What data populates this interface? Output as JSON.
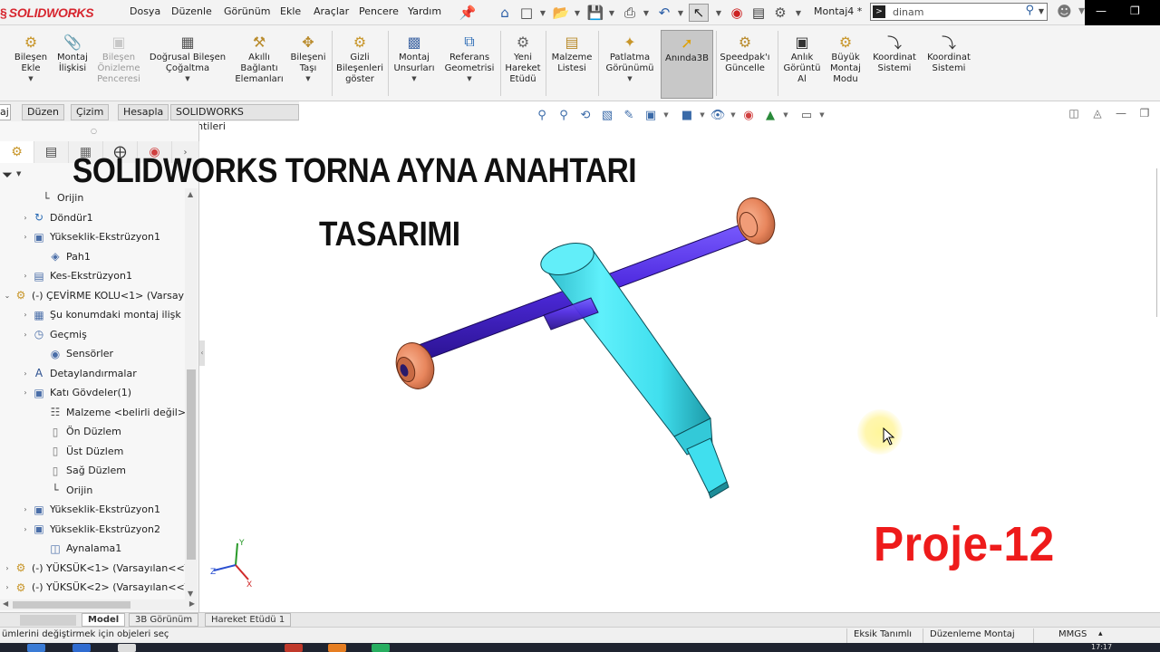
{
  "app": {
    "logo_prefix": "§",
    "logo_name": "SOLIDWORKS",
    "document_name": "Montaj4 *"
  },
  "menu": [
    "Dosya",
    "Düzenle",
    "Görünüm",
    "Ekle",
    "Araçlar",
    "Pencere",
    "Yardım"
  ],
  "search": {
    "tag": ">",
    "value": "dinam"
  },
  "commands": [
    {
      "label": "Bileşen\nEkle",
      "icon": "insert-component-icon"
    },
    {
      "label": "Montaj\nİlişkisi",
      "icon": "mate-icon"
    },
    {
      "label": "Bileşen\nÖnizleme\nPenceresi",
      "icon": "component-preview-icon"
    },
    {
      "label": "Doğrusal Bileşen\nÇoğaltma",
      "icon": "linear-pattern-icon"
    },
    {
      "label": "Akıllı\nBağlantı\nElemanları",
      "icon": "smart-fasteners-icon"
    },
    {
      "label": "Bileşeni\nTaşı",
      "icon": "move-component-icon"
    },
    {
      "label": "Gizli\nBileşenleri\ngöster",
      "icon": "show-hidden-icon"
    },
    {
      "label": "Montaj\nUnsurları",
      "icon": "assembly-features-icon"
    },
    {
      "label": "Referans\nGeometrisi",
      "icon": "reference-geometry-icon"
    },
    {
      "label": "Yeni\nHareket\nEtüdü",
      "icon": "new-motion-study-icon"
    },
    {
      "label": "Malzeme\nListesi",
      "icon": "bill-of-materials-icon"
    },
    {
      "label": "Patlatma\nGörünümü",
      "icon": "exploded-view-icon"
    },
    {
      "label": "Anında3B",
      "icon": "instant3d-icon"
    },
    {
      "label": "Speedpak'ı\nGüncelle",
      "icon": "speedpak-icon"
    },
    {
      "label": "Anlık\nGörüntü\nAl",
      "icon": "snapshot-icon"
    },
    {
      "label": "Büyük\nMontaj\nModu",
      "icon": "large-assembly-icon"
    },
    {
      "label": "Koordinat\nSistemi",
      "icon": "coordinate-system-icon"
    },
    {
      "label": "Koordinat\nSistemi",
      "icon": "coordinate-system-icon"
    }
  ],
  "tabs": [
    "aj",
    "Düzen",
    "Çizim",
    "Hesapla",
    "SOLIDWORKS Eklentileri"
  ],
  "tree": [
    {
      "label": "Orijin",
      "icon": "origin-icon",
      "expander": ""
    },
    {
      "label": "Döndür1",
      "icon": "revolve-icon",
      "expander": "›"
    },
    {
      "label": "Yükseklik-Ekstrüzyon1",
      "icon": "extrude-icon",
      "expander": "›"
    },
    {
      "label": "Pah1",
      "icon": "chamfer-icon",
      "expander": ""
    },
    {
      "label": "Kes-Ekstrüzyon1",
      "icon": "cut-extrude-icon",
      "expander": "›"
    },
    {
      "label": "(-) ÇEVİRME KOLU<1> (Varsay",
      "icon": "part-icon",
      "expander": "⌄"
    },
    {
      "label": "Şu konumdaki montaj ilişk",
      "icon": "mates-folder-icon",
      "expander": "›"
    },
    {
      "label": "Geçmiş",
      "icon": "history-icon",
      "expander": "›"
    },
    {
      "label": "Sensörler",
      "icon": "sensors-icon",
      "expander": ""
    },
    {
      "label": "Detaylandırmalar",
      "icon": "annotations-icon",
      "expander": "›"
    },
    {
      "label": "Katı Gövdeler(1)",
      "icon": "solid-bodies-icon",
      "expander": "›"
    },
    {
      "label": "Malzeme <belirli değil>",
      "icon": "material-icon",
      "expander": ""
    },
    {
      "label": "Ön Düzlem",
      "icon": "plane-icon",
      "expander": ""
    },
    {
      "label": "Üst Düzlem",
      "icon": "plane-icon",
      "expander": ""
    },
    {
      "label": "Sağ Düzlem",
      "icon": "plane-icon",
      "expander": ""
    },
    {
      "label": "Orijin",
      "icon": "origin-icon",
      "expander": ""
    },
    {
      "label": "Yükseklik-Ekstrüzyon1",
      "icon": "extrude-icon",
      "expander": "›"
    },
    {
      "label": "Yükseklik-Ekstrüzyon2",
      "icon": "extrude-icon",
      "expander": "›"
    },
    {
      "label": "Aynalama1",
      "icon": "mirror-icon",
      "expander": ""
    },
    {
      "label": "(-) YÜKSÜK<1> (Varsayılan<<\\",
      "icon": "part-icon",
      "expander": "›"
    },
    {
      "label": "(-) YÜKSÜK<2> (Varsayılan<<\\",
      "icon": "part-icon",
      "expander": "›"
    }
  ],
  "overlay": {
    "title_line1": "SOLIDWORKS TORNA AYNA ANAHTARI",
    "title_line2": "TASARIMI",
    "project": "Proje-12"
  },
  "bottom_tabs": [
    "Model",
    "3B Görünüm",
    "Hareket Etüdü 1"
  ],
  "status": {
    "hint": "ümlerini değiştirmek için objeleri seç",
    "definition": "Eksik Tanımlı",
    "mode": "Düzenleme Montaj",
    "units": "MMGS",
    "units_arrow": "▴"
  },
  "taskbar": {
    "time": "17:17"
  },
  "colors": {
    "logo_red": "#d7262f",
    "handle_cyan": "#40dfee",
    "bar_purple": "#4f2be0",
    "knob_orange": "#e8865d",
    "project_red": "#ee1b1b"
  }
}
